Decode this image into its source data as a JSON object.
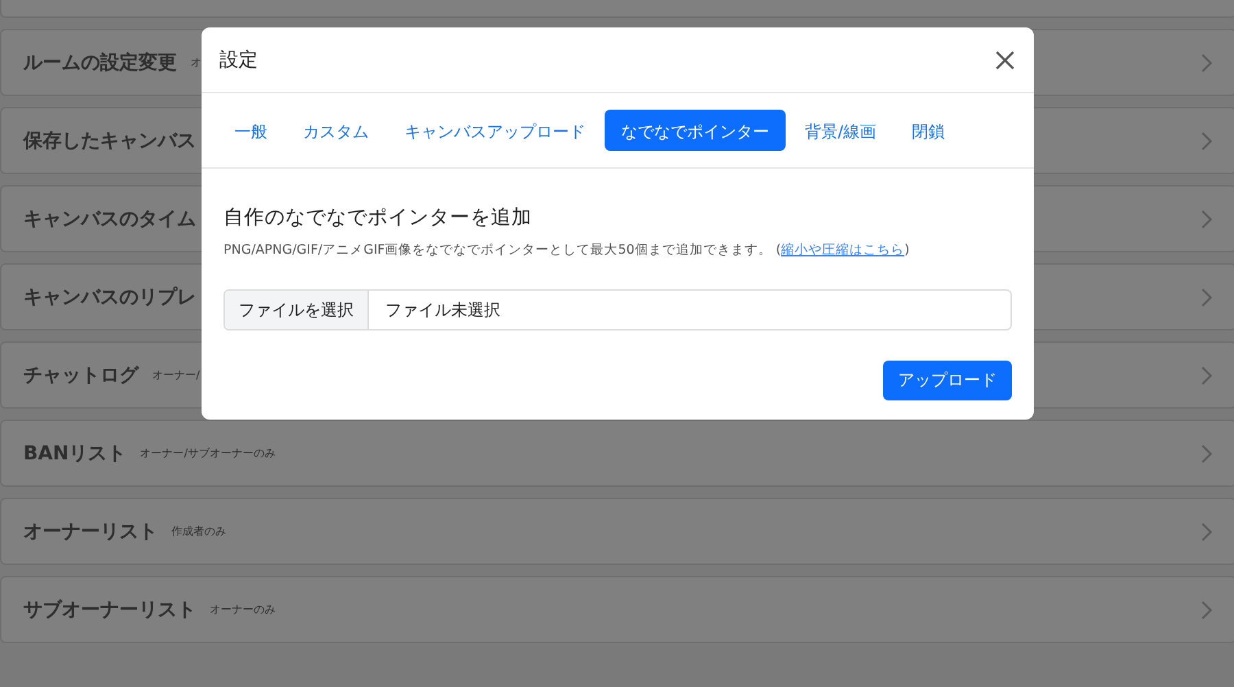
{
  "rows": [
    {
      "title": "",
      "note": ""
    },
    {
      "title": "ルームの設定変更",
      "note": "オ"
    },
    {
      "title": "保存したキャンバス",
      "note": ""
    },
    {
      "title": "キャンバスのタイム",
      "note": ""
    },
    {
      "title": "キャンバスのリプレ",
      "note": ""
    },
    {
      "title": "チャットログ",
      "note": "オーナー/"
    },
    {
      "title": "BANリスト",
      "note": "オーナー/サブオーナーのみ"
    },
    {
      "title": "オーナーリスト",
      "note": "作成者のみ"
    },
    {
      "title": "サブオーナーリスト",
      "note": "オーナーのみ"
    }
  ],
  "dialog": {
    "title": "設定",
    "tabs": [
      {
        "label": "一般",
        "selected": false
      },
      {
        "label": "カスタム",
        "selected": false
      },
      {
        "label": "キャンバスアップロード",
        "selected": false
      },
      {
        "label": "なでなでポインター",
        "selected": true
      },
      {
        "label": "背景/線画",
        "selected": false
      },
      {
        "label": "閉鎖",
        "selected": false
      }
    ],
    "heading": "自作のなでなでポインターを追加",
    "description": "PNG/APNG/GIF/アニメGIF画像をなでなでポインターとして最大50個まで追加できます。 (",
    "link": "縮小や圧縮はこちら",
    "description_end": ")",
    "file_button": "ファイルを選択",
    "file_status": "ファイル未選択",
    "upload_button": "アップロード"
  }
}
